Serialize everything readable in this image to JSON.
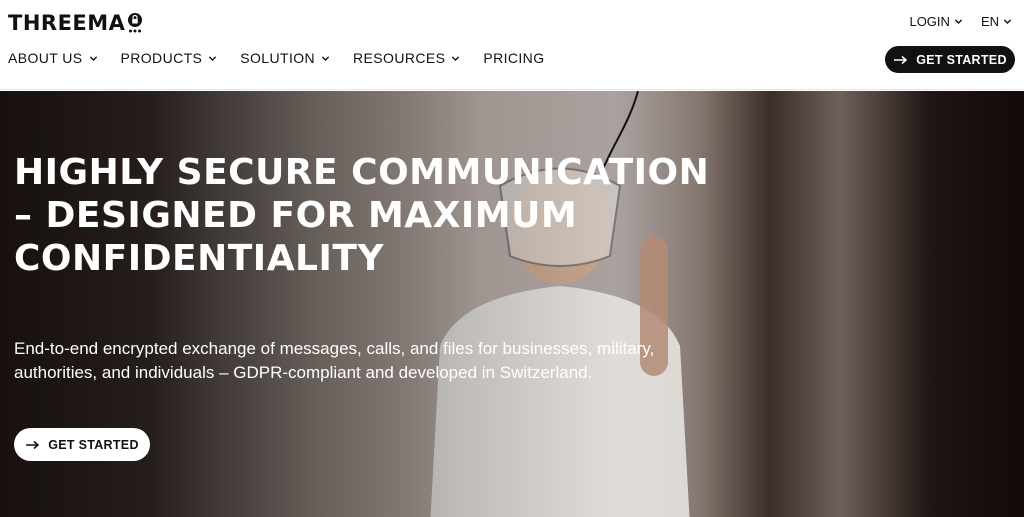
{
  "header": {
    "logo_text": "THREEMA",
    "top_links": {
      "login": "LOGIN",
      "language": "EN"
    },
    "nav": [
      {
        "label": "ABOUT US"
      },
      {
        "label": "PRODUCTS"
      },
      {
        "label": "SOLUTION"
      },
      {
        "label": "RESOURCES"
      },
      {
        "label": "PRICING"
      }
    ],
    "cta": "GET STARTED"
  },
  "hero": {
    "title": "HIGHLY SECURE COMMUNICATION – DESIGNED FOR MAXIMUM CONFIDENTIALITY",
    "description": "End-to-end encrypted exchange of messages, calls, and files for businesses, military, authorities, and individuals – GDPR-compliant and developed in Switzerland.",
    "cta": "GET STARTED"
  },
  "colors": {
    "brand_dark": "#111111",
    "background": "#ffffff",
    "hero_text": "#ffffff"
  }
}
